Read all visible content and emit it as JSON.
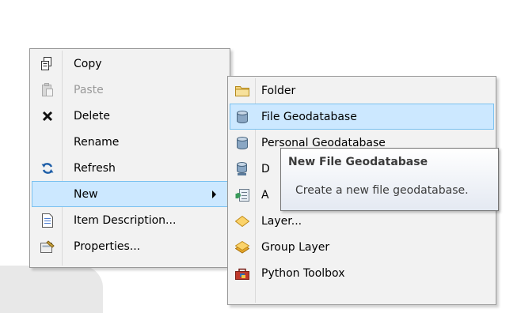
{
  "main_menu": {
    "items": [
      {
        "label": "Copy",
        "icon": "copy-icon",
        "disabled": false
      },
      {
        "label": "Paste",
        "icon": "paste-icon",
        "disabled": true
      },
      {
        "label": "Delete",
        "icon": "delete-icon",
        "disabled": false
      },
      {
        "label": "Rename",
        "icon": "",
        "disabled": false
      },
      {
        "label": "Refresh",
        "icon": "refresh-icon",
        "disabled": false
      },
      {
        "label": "New",
        "icon": "",
        "disabled": false,
        "selected": true,
        "has_submenu": true
      },
      {
        "label": "Item Description...",
        "icon": "item-description-icon",
        "disabled": false
      },
      {
        "label": "Properties...",
        "icon": "properties-icon",
        "disabled": false
      }
    ]
  },
  "sub_menu": {
    "items": [
      {
        "label": "Folder",
        "icon": "folder-icon"
      },
      {
        "label": "File Geodatabase",
        "icon": "geodatabase-icon",
        "selected": true
      },
      {
        "label": "Personal Geodatabase",
        "icon": "geodatabase-icon"
      },
      {
        "label": "D",
        "icon": "database-connection-icon"
      },
      {
        "label": "A",
        "icon": "address-locator-icon"
      },
      {
        "label": "Layer...",
        "icon": "layer-icon"
      },
      {
        "label": "Group Layer",
        "icon": "group-layer-icon"
      },
      {
        "label": "Python Toolbox",
        "icon": "python-toolbox-icon"
      }
    ]
  },
  "tooltip": {
    "title": "New File Geodatabase",
    "description": "Create a new file geodatabase."
  },
  "colors": {
    "menu_background": "#f2f2f2",
    "selection_fill": "#cce8ff",
    "selection_border": "#7ac1f0",
    "disabled_text": "#9a9a9a"
  }
}
